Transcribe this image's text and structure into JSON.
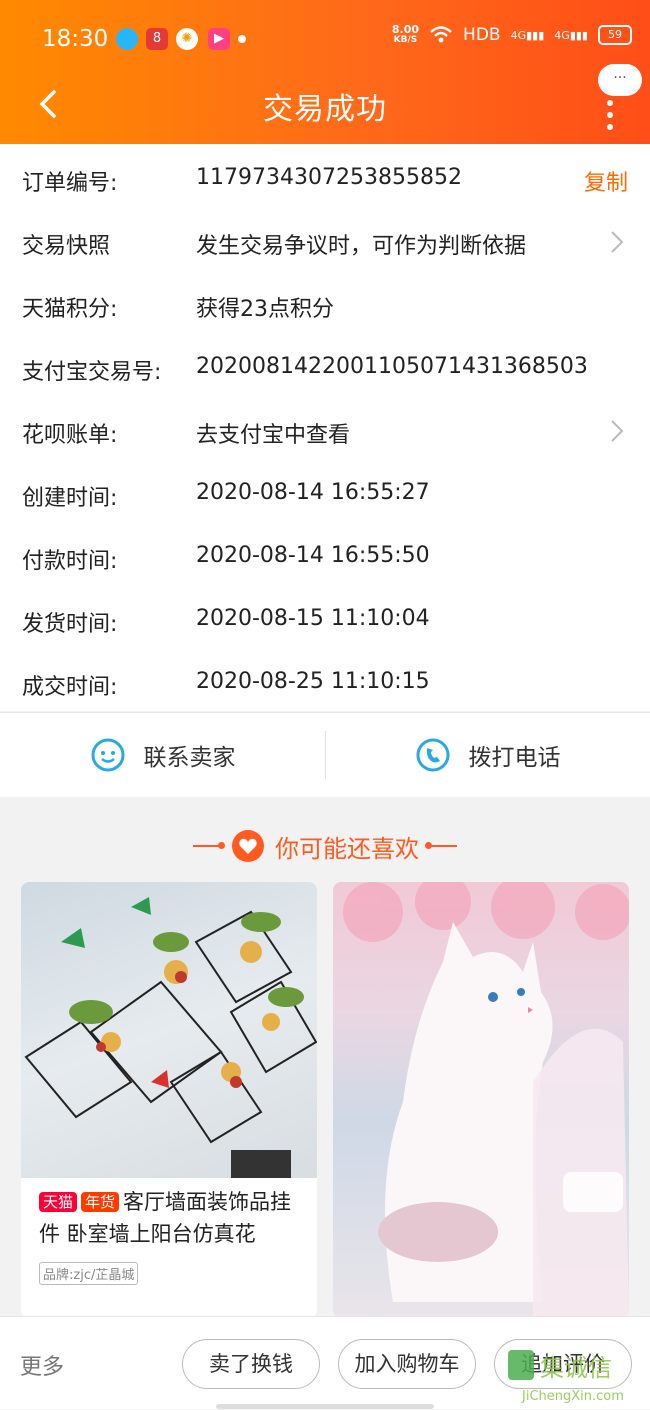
{
  "status": {
    "time": "18:30",
    "speed_top": "8.00",
    "speed_unit": "KB/S",
    "hd": "HDB",
    "net1": "4G",
    "net2": "4G",
    "battery": "59"
  },
  "nav": {
    "title": "交易成功",
    "more_bubble": "···"
  },
  "order": {
    "rows": [
      {
        "label": "订单编号:",
        "value": "1179734307253855852",
        "action": "复制"
      },
      {
        "label": "交易快照",
        "value": "发生交易争议时，可作为判断依据"
      },
      {
        "label": "天猫积分:",
        "value": "获得23点积分"
      },
      {
        "label": "支付宝交易号:",
        "value": "2020081422001105071431368503"
      },
      {
        "label": "花呗账单:",
        "value": "去支付宝中查看"
      },
      {
        "label": "创建时间:",
        "value": "2020-08-14 16:55:27"
      },
      {
        "label": "付款时间:",
        "value": "2020-08-14 16:55:50"
      },
      {
        "label": "发货时间:",
        "value": "2020-08-15 11:10:04"
      },
      {
        "label": "成交时间:",
        "value": "2020-08-25 11:10:15"
      }
    ]
  },
  "contact": {
    "seller": "联系卖家",
    "phone": "拨打电话"
  },
  "recommend": {
    "title": "你可能还喜欢",
    "items": [
      {
        "tags": [
          "天猫",
          "年货"
        ],
        "name": "客厅墙面装饰品挂件 卧室墙上阳台仿真花",
        "brand": "品牌:zjc/芷晶城"
      }
    ]
  },
  "bottom": {
    "more": "更多",
    "buttons": [
      "卖了换钱",
      "加入购物车",
      "追加评价"
    ]
  },
  "watermark": {
    "text": "JiChengXin.com",
    "chars": "集诚信"
  },
  "colors": {
    "accent": "#ff6a00",
    "header_start": "#ff8a00",
    "header_end": "#ff4e17",
    "contact_icon": "#29a9e0"
  }
}
